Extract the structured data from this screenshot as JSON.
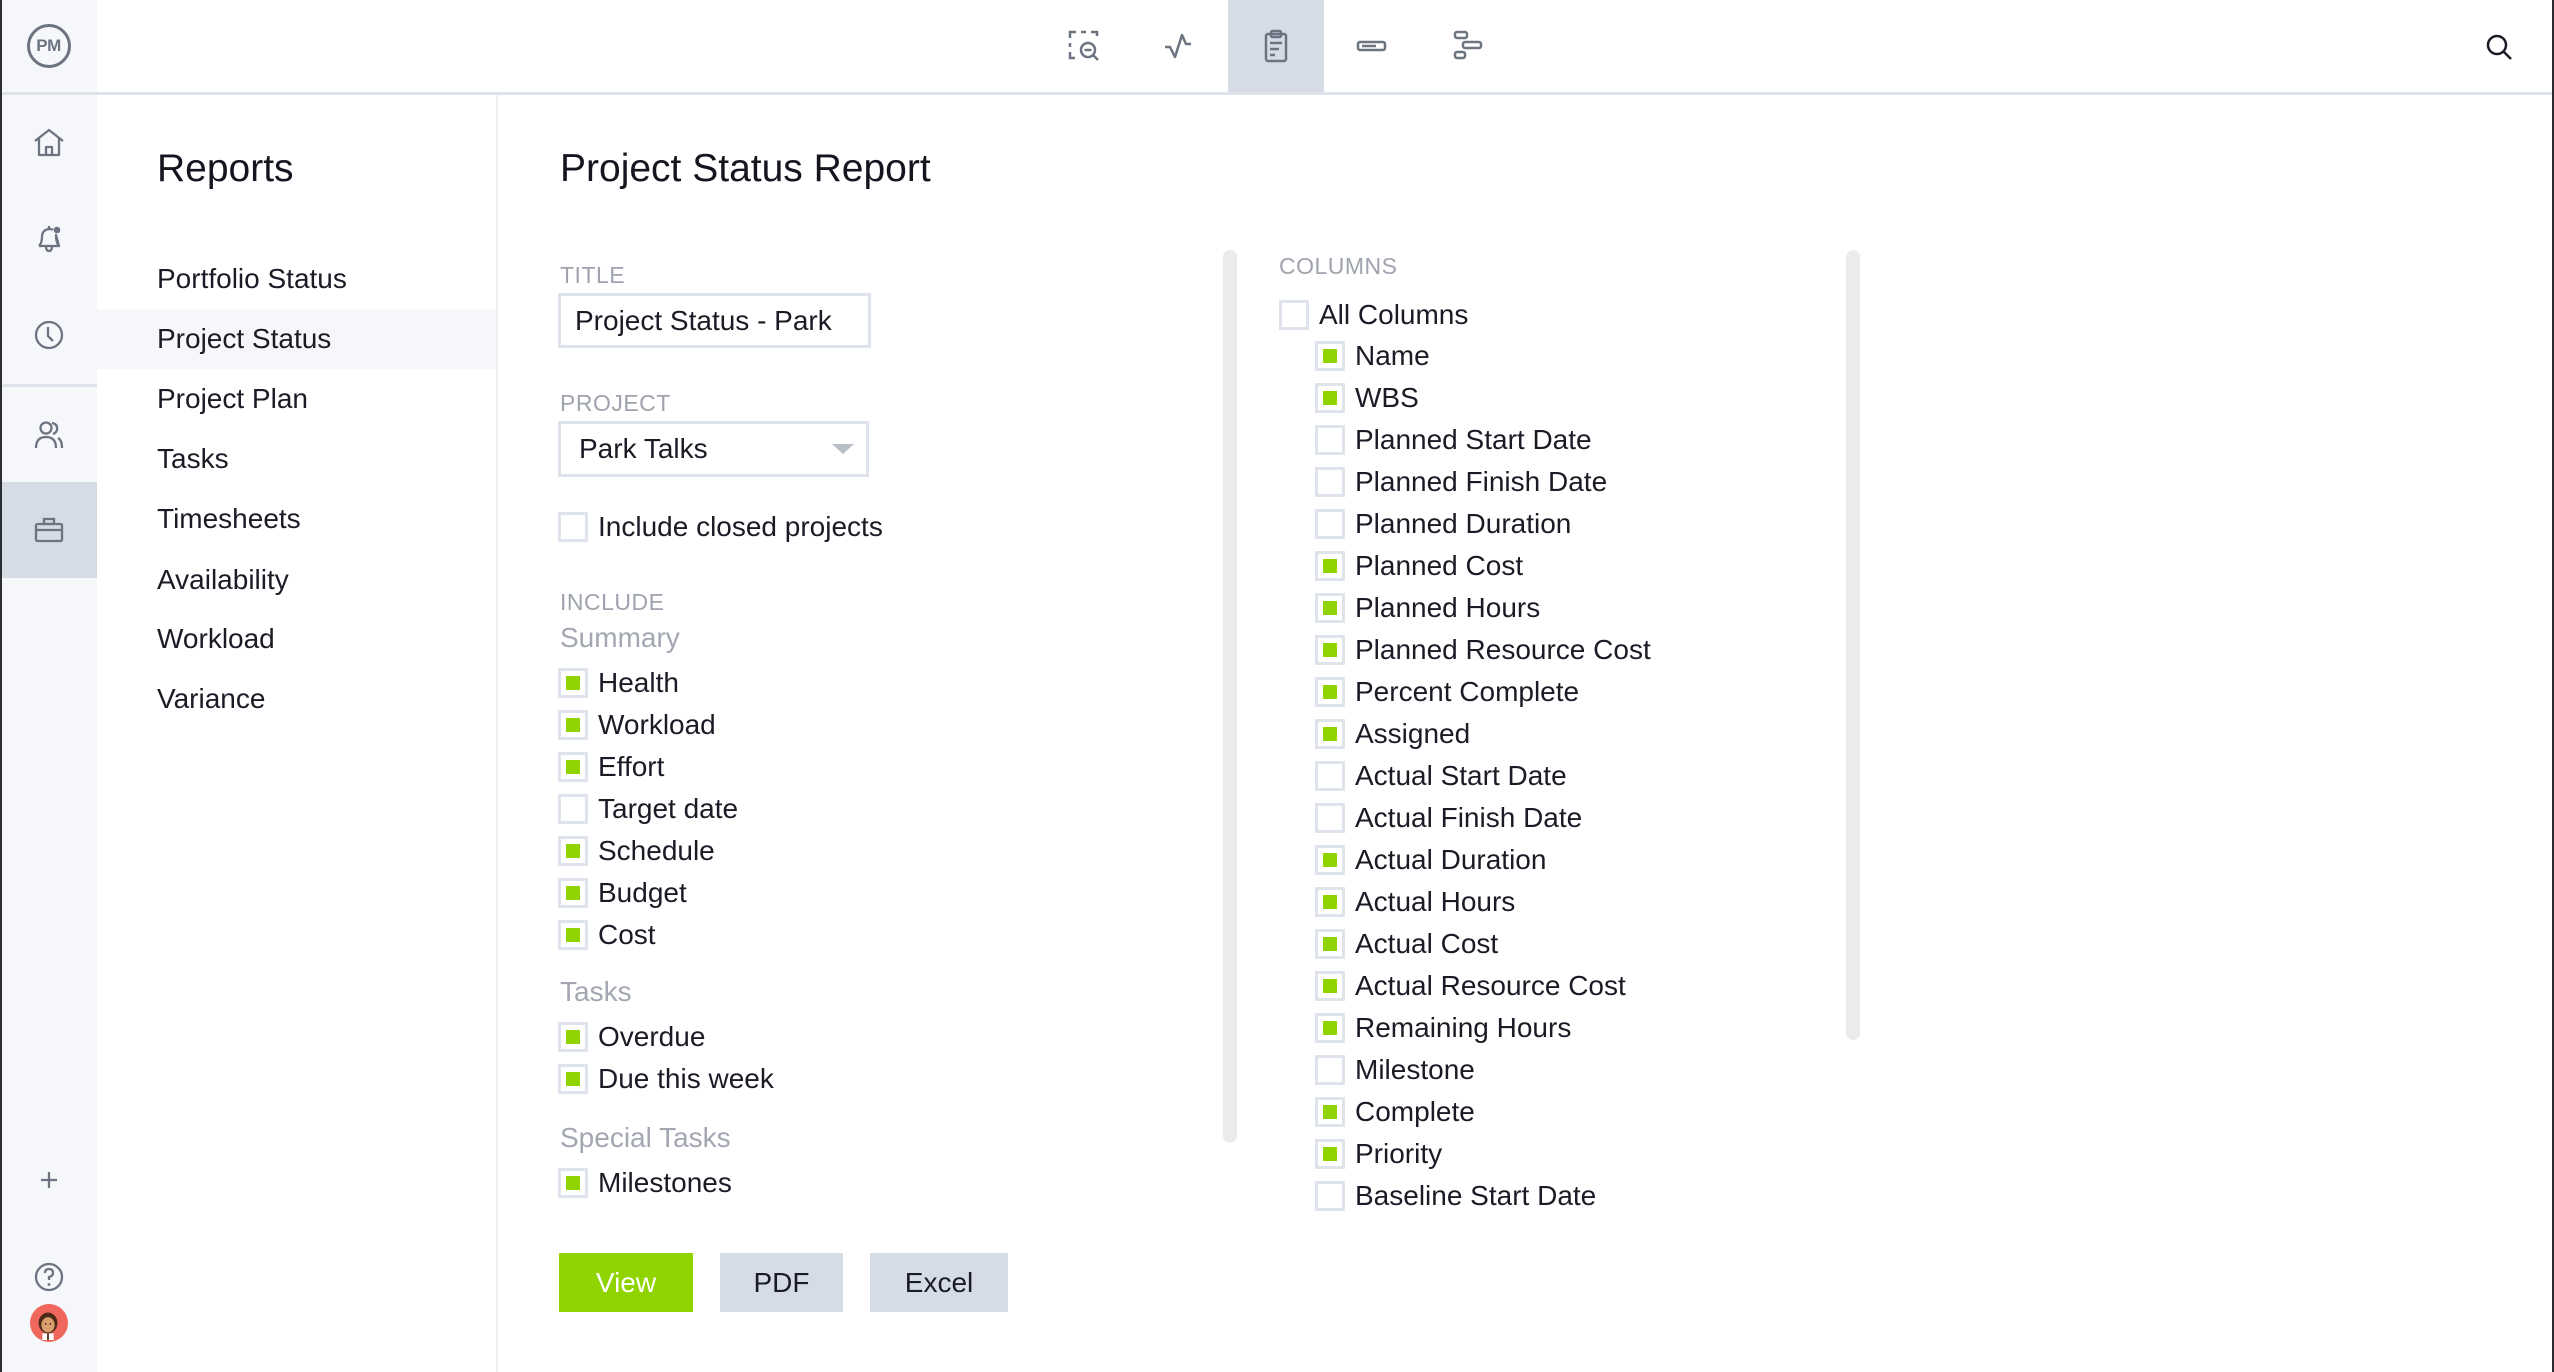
{
  "app": {
    "logo_text": "PM"
  },
  "topbar": {
    "view_tabs": [
      {
        "name": "portfolio-view",
        "icon": "zoom-select-icon",
        "active": false
      },
      {
        "name": "dashboard-view",
        "icon": "pulse-icon",
        "active": false
      },
      {
        "name": "reports-view",
        "icon": "clipboard-icon",
        "active": true
      },
      {
        "name": "workload-view",
        "icon": "bar-icon",
        "active": false
      },
      {
        "name": "gantt-view",
        "icon": "gantt-icon",
        "active": false
      }
    ],
    "search_icon": "search-icon"
  },
  "rail": {
    "items": [
      {
        "name": "home",
        "icon": "home-icon",
        "active": false
      },
      {
        "name": "notifications",
        "icon": "bell-icon",
        "active": false,
        "has_badge": true
      },
      {
        "name": "timesheets",
        "icon": "clock-icon",
        "active": false
      },
      {
        "name": "team",
        "icon": "users-icon",
        "active": false
      },
      {
        "name": "projects",
        "icon": "briefcase-icon",
        "active": true
      }
    ],
    "bottom": [
      {
        "name": "add",
        "icon": "plus-icon"
      },
      {
        "name": "help",
        "icon": "help-icon"
      },
      {
        "name": "profile",
        "icon": "avatar"
      }
    ]
  },
  "reports_nav": {
    "title": "Reports",
    "items": [
      {
        "label": "Portfolio Status",
        "active": false
      },
      {
        "label": "Project Status",
        "active": true
      },
      {
        "label": "Project Plan",
        "active": false
      },
      {
        "label": "Tasks",
        "active": false
      },
      {
        "label": "Timesheets",
        "active": false
      },
      {
        "label": "Availability",
        "active": false
      },
      {
        "label": "Workload",
        "active": false
      },
      {
        "label": "Variance",
        "active": false
      }
    ]
  },
  "main": {
    "title": "Project Status Report",
    "title_field": {
      "label": "TITLE",
      "value": "Project Status - Park"
    },
    "project_field": {
      "label": "PROJECT",
      "value": "Park Talks"
    },
    "include_closed": {
      "label": "Include closed projects",
      "checked": false
    },
    "include": {
      "label": "INCLUDE",
      "groups": [
        {
          "label": "Summary",
          "items": [
            {
              "label": "Health",
              "checked": true
            },
            {
              "label": "Workload",
              "checked": true
            },
            {
              "label": "Effort",
              "checked": true
            },
            {
              "label": "Target date",
              "checked": false
            },
            {
              "label": "Schedule",
              "checked": true
            },
            {
              "label": "Budget",
              "checked": true
            },
            {
              "label": "Cost",
              "checked": true
            }
          ]
        },
        {
          "label": "Tasks",
          "items": [
            {
              "label": "Overdue",
              "checked": true
            },
            {
              "label": "Due this week",
              "checked": true
            }
          ]
        },
        {
          "label": "Special Tasks",
          "items": [
            {
              "label": "Milestones",
              "checked": true
            }
          ]
        }
      ]
    },
    "columns": {
      "label": "COLUMNS",
      "all": {
        "label": "All Columns",
        "checked": false
      },
      "items": [
        {
          "label": "Name",
          "checked": true
        },
        {
          "label": "WBS",
          "checked": true
        },
        {
          "label": "Planned Start Date",
          "checked": false
        },
        {
          "label": "Planned Finish Date",
          "checked": false
        },
        {
          "label": "Planned Duration",
          "checked": false
        },
        {
          "label": "Planned Cost",
          "checked": true
        },
        {
          "label": "Planned Hours",
          "checked": true
        },
        {
          "label": "Planned Resource Cost",
          "checked": true
        },
        {
          "label": "Percent Complete",
          "checked": true
        },
        {
          "label": "Assigned",
          "checked": true
        },
        {
          "label": "Actual Start Date",
          "checked": false
        },
        {
          "label": "Actual Finish Date",
          "checked": false
        },
        {
          "label": "Actual Duration",
          "checked": true
        },
        {
          "label": "Actual Hours",
          "checked": true
        },
        {
          "label": "Actual Cost",
          "checked": true
        },
        {
          "label": "Actual Resource Cost",
          "checked": true
        },
        {
          "label": "Remaining Hours",
          "checked": true
        },
        {
          "label": "Milestone",
          "checked": false
        },
        {
          "label": "Complete",
          "checked": true
        },
        {
          "label": "Priority",
          "checked": true
        },
        {
          "label": "Baseline Start Date",
          "checked": false
        }
      ]
    },
    "buttons": {
      "view": "View",
      "pdf": "PDF",
      "excel": "Excel"
    }
  },
  "colors": {
    "accent": "#8fd400",
    "active_bg": "#d6dce6",
    "rail_bg": "#f5f7fa",
    "border": "#dfe3ec",
    "muted_text": "#9ea3ad"
  }
}
